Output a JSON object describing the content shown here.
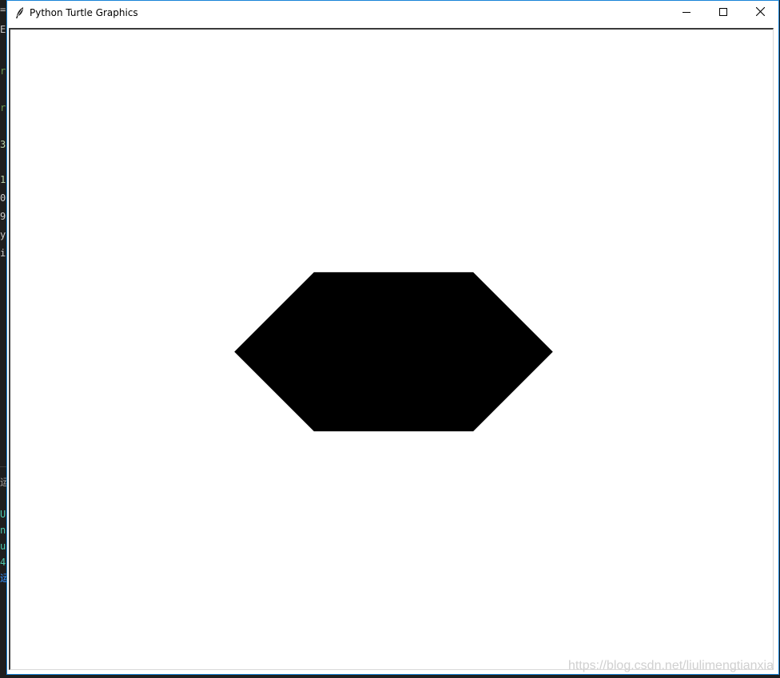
{
  "window": {
    "title": "Python Turtle Graphics",
    "accent_color": "#1883d7",
    "buttons": {
      "minimize": "minimize-icon",
      "maximize": "maximize-icon",
      "close": "close-icon"
    }
  },
  "canvas": {
    "background": "#ffffff",
    "shape": {
      "type": "hexagon",
      "fill": "#000000"
    }
  },
  "watermark": "https://blog.csdn.net/liulimengtianxia",
  "background_glimpses": [
    {
      "text": "=",
      "color": "#c8c8c8"
    },
    {
      "text": "E",
      "color": "#c8c8c8"
    },
    {
      "text": "r",
      "color": "#6a9955"
    },
    {
      "text": "r",
      "color": "#6a9955"
    },
    {
      "text": "3",
      "color": "#b5cea8"
    },
    {
      "text": "1",
      "color": "#b5cea8"
    },
    {
      "text": "0",
      "color": "#c8c8c8"
    },
    {
      "text": "9",
      "color": "#c8c8c8"
    },
    {
      "text": "y",
      "color": "#c8c8c8"
    },
    {
      "text": "i",
      "color": "#c8c8c8"
    },
    {
      "text": "运",
      "color": "#9e9e9e"
    },
    {
      "text": "U",
      "color": "#4ec9b0"
    },
    {
      "text": "n",
      "color": "#4ec9b0"
    },
    {
      "text": "u",
      "color": "#4ec9b0"
    },
    {
      "text": "4",
      "color": "#4ec9b0"
    },
    {
      "text": "运",
      "color": "#3794ff"
    }
  ]
}
